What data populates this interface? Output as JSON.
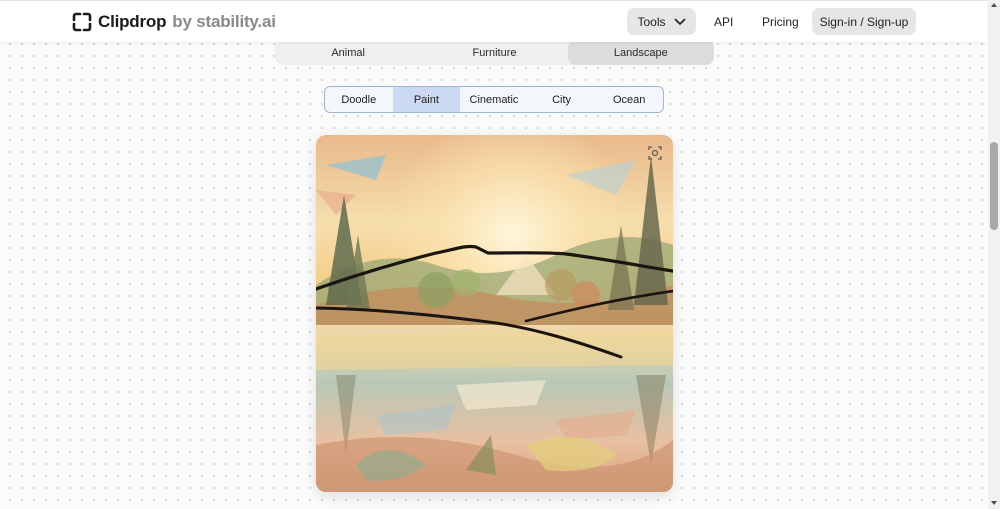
{
  "header": {
    "brand": "Clipdrop",
    "brand_suffix": "by stability.ai",
    "logo_icon": "clipdrop-bracket-icon",
    "nav": {
      "tools_label": "Tools",
      "tools_icon": "chevron-down-icon",
      "api_label": "API",
      "pricing_label": "Pricing",
      "signin_label": "Sign-in / Sign-up"
    }
  },
  "categories": {
    "items": [
      {
        "label": "Animal",
        "active": false
      },
      {
        "label": "Furniture",
        "active": false
      },
      {
        "label": "Landscape",
        "active": true
      }
    ]
  },
  "styles": {
    "items": [
      {
        "label": "Doodle",
        "active": false
      },
      {
        "label": "Paint",
        "active": true
      },
      {
        "label": "Cinematic",
        "active": false
      },
      {
        "label": "City",
        "active": false
      },
      {
        "label": "Ocean",
        "active": false
      }
    ]
  },
  "preview": {
    "expand_icon": "expand-icon"
  },
  "colors": {
    "accent_tab": "#ccd9f3",
    "tab_border": "#9fb6d4",
    "button_bg": "#e6e6e6"
  }
}
